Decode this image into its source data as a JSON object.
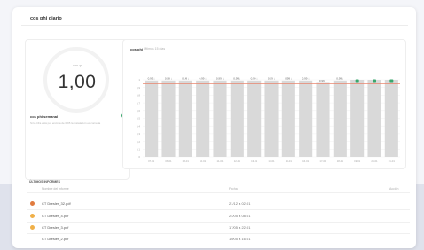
{
  "card": {
    "title": "cos phi diario"
  },
  "gauge": {
    "unit": "cos φ",
    "value": "1,00"
  },
  "weekly": {
    "title": "cos phi semanal",
    "subtitle": "Si la cifra está por encima de 0,95 la instalación es correcta",
    "status_color": "#3aa76d"
  },
  "chart_panel": {
    "title": "cos phi",
    "subtitle": "Últimos 15 días"
  },
  "chart_data": {
    "type": "bar",
    "categories": [
      "07-01",
      "08-01",
      "09-01",
      "10-01",
      "11-01",
      "12-01",
      "13-01",
      "14-01",
      "15-01",
      "16-01",
      "17-01",
      "18-01",
      "19-01",
      "20-01",
      "21-01"
    ],
    "values": [
      0.99,
      0.99,
      0.99,
      0.99,
      0.99,
      0.99,
      0.99,
      0.99,
      0.99,
      0.99,
      0.96,
      0.99,
      1.0,
      1.0,
      1.0
    ],
    "value_labels": [
      "0,99 ↓",
      "0,99 ↓",
      "0,99 ↓",
      "0,99 ↓",
      "0,99 ↓",
      "0,99 ↓",
      "0,99 ↓",
      "0,99 ↓",
      "0,99 ↓",
      "0,99 ↓",
      "0,96 ↓",
      "0,99 ↓",
      "",
      "",
      ""
    ],
    "badge_flags": [
      false,
      false,
      false,
      false,
      false,
      false,
      false,
      false,
      false,
      false,
      false,
      false,
      true,
      true,
      true
    ],
    "yticks": [
      "1",
      "0,9",
      "0,8",
      "0,7",
      "0,6",
      "0,5",
      "0,4",
      "0,3",
      "0,2",
      "0,1",
      "0"
    ],
    "ylim": [
      0,
      1.0
    ],
    "threshold": 0.95,
    "bar_color": "#d9d9d9",
    "threshold_color": "#e8866f",
    "badge_color": "#3aa76d",
    "title": "cos phi",
    "xlabel": "",
    "ylabel": "",
    "grid": true
  },
  "reports": {
    "section_title": "ÚLTIMOS INFORMES",
    "headers": {
      "name": "Nombre del informe",
      "date": "Fecha",
      "action": "Acción"
    },
    "rows": [
      {
        "name": "CT Dresler_32.pdf",
        "date": "21/12 a 02:01",
        "status_color": "#e07b3f"
      },
      {
        "name": "CT Dresler_4.pdf",
        "date": "24/05 a 08:01",
        "status_color": "#f0b048"
      },
      {
        "name": "CT Dresler_3.pdf",
        "date": "17/05 a 22:01",
        "status_color": "#f0b048"
      },
      {
        "name": "CT Dresler_2.pdf",
        "date": "10/05 a 16:01",
        "status_color": ""
      }
    ]
  }
}
